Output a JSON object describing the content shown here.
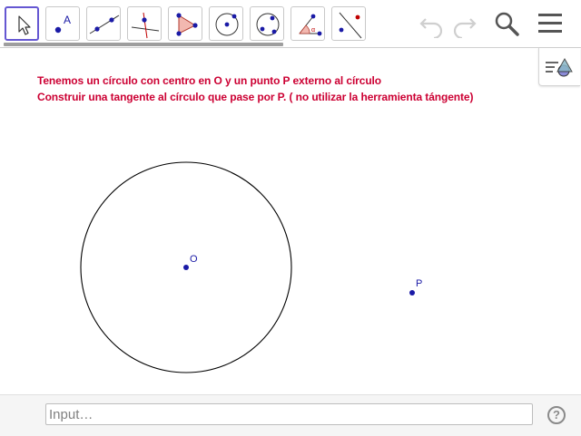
{
  "toolbar": {
    "tools": [
      {
        "name": "move-tool-icon",
        "selected": true
      },
      {
        "name": "point-tool-icon",
        "label": "A"
      },
      {
        "name": "line-tool-icon"
      },
      {
        "name": "perpendicular-line-tool-icon"
      },
      {
        "name": "polygon-tool-icon"
      },
      {
        "name": "circle-center-point-tool-icon"
      },
      {
        "name": "circle-three-points-tool-icon"
      },
      {
        "name": "angle-tool-icon",
        "label": "α"
      },
      {
        "name": "reflect-tool-icon"
      }
    ],
    "undo_icon": "undo-icon",
    "redo_icon": "redo-icon",
    "search_icon": "search-icon",
    "menu_icon": "hamburger-menu-icon"
  },
  "instructions": {
    "line1": "Tenemos un círculo con centro en O y un punto P externo al círculo",
    "line2": "Construir una tangente al círculo que pase por P. ( no utilizar la herramienta tángente)"
  },
  "graphics": {
    "points": [
      {
        "label": "O"
      },
      {
        "label": "P"
      }
    ]
  },
  "input_bar": {
    "placeholder": "Input…",
    "help": "?"
  },
  "colors": {
    "accent": "#6557d2",
    "instruction_text": "#cc0033",
    "point": "#1a1aa6",
    "point_label": "#1a1aa6"
  }
}
